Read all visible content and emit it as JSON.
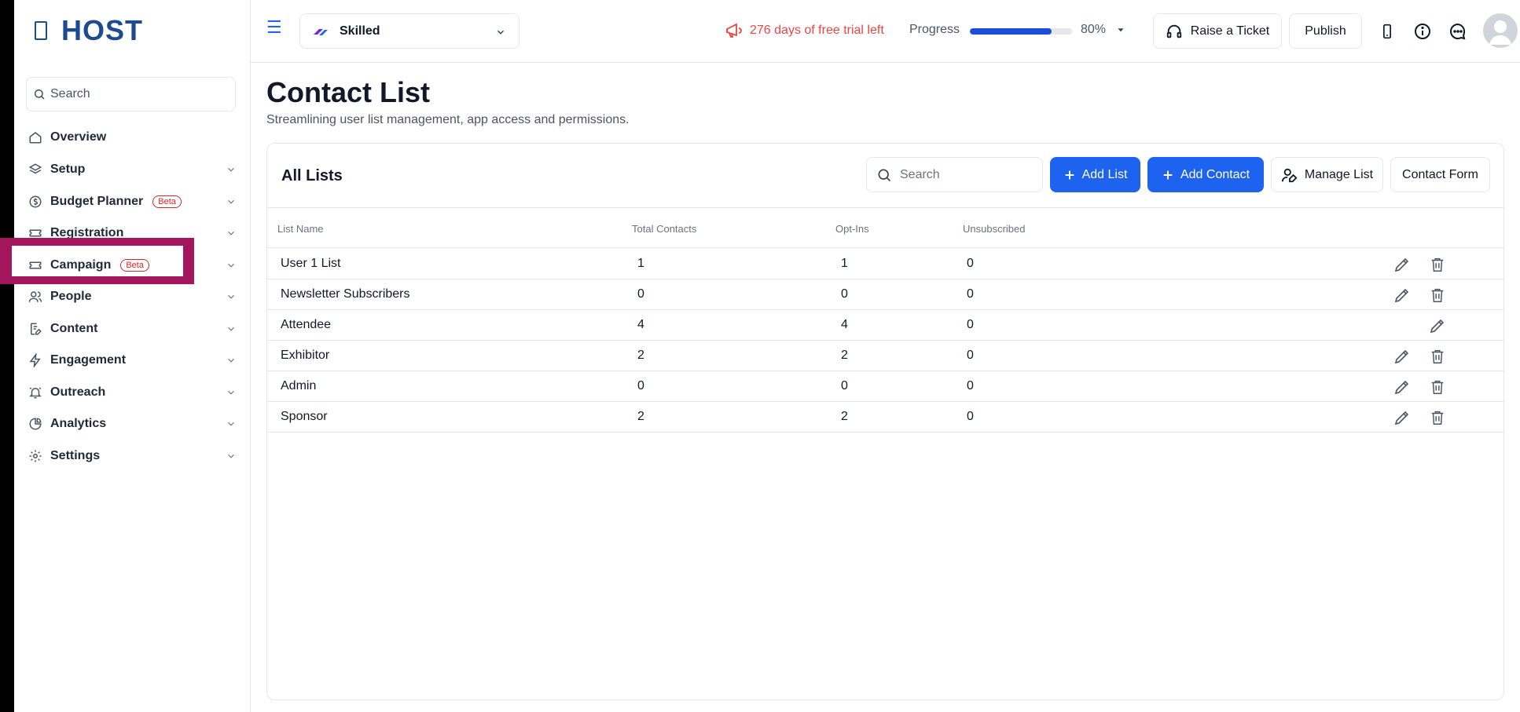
{
  "brand": {
    "name": "HOST"
  },
  "sidebar": {
    "search_placeholder": "Search",
    "items": [
      {
        "label": "Overview",
        "icon": "home-icon",
        "chevron": false
      },
      {
        "label": "Setup",
        "icon": "layers-icon",
        "chevron": true
      },
      {
        "label": "Budget Planner",
        "icon": "dollar-circle-icon",
        "badge": "Beta",
        "chevron": true
      },
      {
        "label": "Registration",
        "icon": "ticket-icon",
        "chevron": true
      },
      {
        "label": "Campaign",
        "icon": "ticket-icon",
        "badge": "Beta",
        "chevron": true
      },
      {
        "label": "People",
        "icon": "users-icon",
        "chevron": true
      },
      {
        "label": "Content",
        "icon": "file-edit-icon",
        "chevron": true
      },
      {
        "label": "Engagement",
        "icon": "lightning-icon",
        "chevron": true
      },
      {
        "label": "Outreach",
        "icon": "bell-icon",
        "chevron": true
      },
      {
        "label": "Analytics",
        "icon": "pie-chart-icon",
        "chevron": true
      },
      {
        "label": "Settings",
        "icon": "gear-icon",
        "chevron": true
      }
    ]
  },
  "topbar": {
    "event_name": "Skilled",
    "trial_text": "276 days of free trial left",
    "progress_label": "Progress",
    "progress_value": 0.8,
    "progress_text": "80%",
    "raise_ticket": "Raise a Ticket",
    "publish": "Publish"
  },
  "page": {
    "title": "Contact List",
    "subtitle": "Streamlining user list management, app access and permissions."
  },
  "card": {
    "title": "All Lists",
    "search_placeholder": "Search",
    "add_list": "Add List",
    "add_contact": "Add Contact",
    "manage_list": "Manage List",
    "contact_form": "Contact Form"
  },
  "table": {
    "columns": [
      "List Name",
      "Total Contacts",
      "Opt-Ins",
      "Unsubscribed"
    ],
    "rows": [
      {
        "name": "User 1 List",
        "total": "1",
        "optins": "1",
        "unsub": "0",
        "deletable": true
      },
      {
        "name": "Newsletter Subscribers",
        "total": "0",
        "optins": "0",
        "unsub": "0",
        "deletable": true
      },
      {
        "name": "Attendee",
        "total": "4",
        "optins": "4",
        "unsub": "0",
        "deletable": false
      },
      {
        "name": "Exhibitor",
        "total": "2",
        "optins": "2",
        "unsub": "0",
        "deletable": true
      },
      {
        "name": "Admin",
        "total": "0",
        "optins": "0",
        "unsub": "0",
        "deletable": true
      },
      {
        "name": "Sponsor",
        "total": "2",
        "optins": "2",
        "unsub": "0",
        "deletable": true
      }
    ]
  },
  "colors": {
    "accent": "#1d63f0",
    "brand": "#1e4b8f",
    "warning": "#ef4444",
    "highlight": "#a3165d"
  }
}
